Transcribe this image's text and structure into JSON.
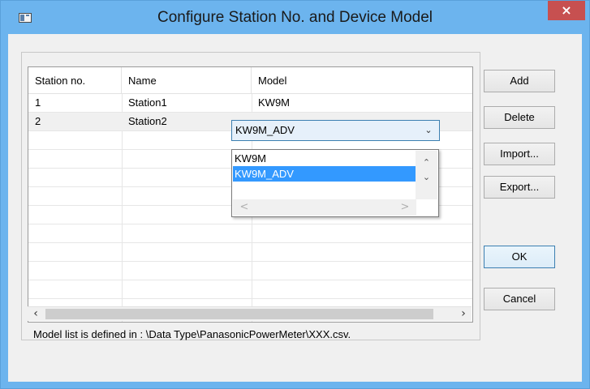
{
  "window": {
    "title": "Configure Station No. and Device Model",
    "close_label": "×"
  },
  "grid": {
    "columns": [
      "Station no.",
      "Name",
      "Model"
    ],
    "rows": [
      {
        "station": "1",
        "name": "Station1",
        "model": "KW9M"
      },
      {
        "station": "2",
        "name": "Station2",
        "model": "KW9M_ADV"
      }
    ],
    "editing_row_index": 1
  },
  "model_combo": {
    "value": "KW9M_ADV",
    "options": [
      "KW9M",
      "KW9M_ADV"
    ],
    "highlighted_option": "KW9M_ADV"
  },
  "buttons": {
    "add": "Add",
    "delete": "Delete",
    "import": "Import...",
    "export": "Export...",
    "ok": "OK",
    "cancel": "Cancel"
  },
  "info_text": "Model list is defined in : \\Data Type\\PanasonicPowerMeter\\XXX.csv.",
  "colors": {
    "title_bar": "#6cb4ee",
    "close_button": "#c75050",
    "selection": "#3399ff"
  }
}
